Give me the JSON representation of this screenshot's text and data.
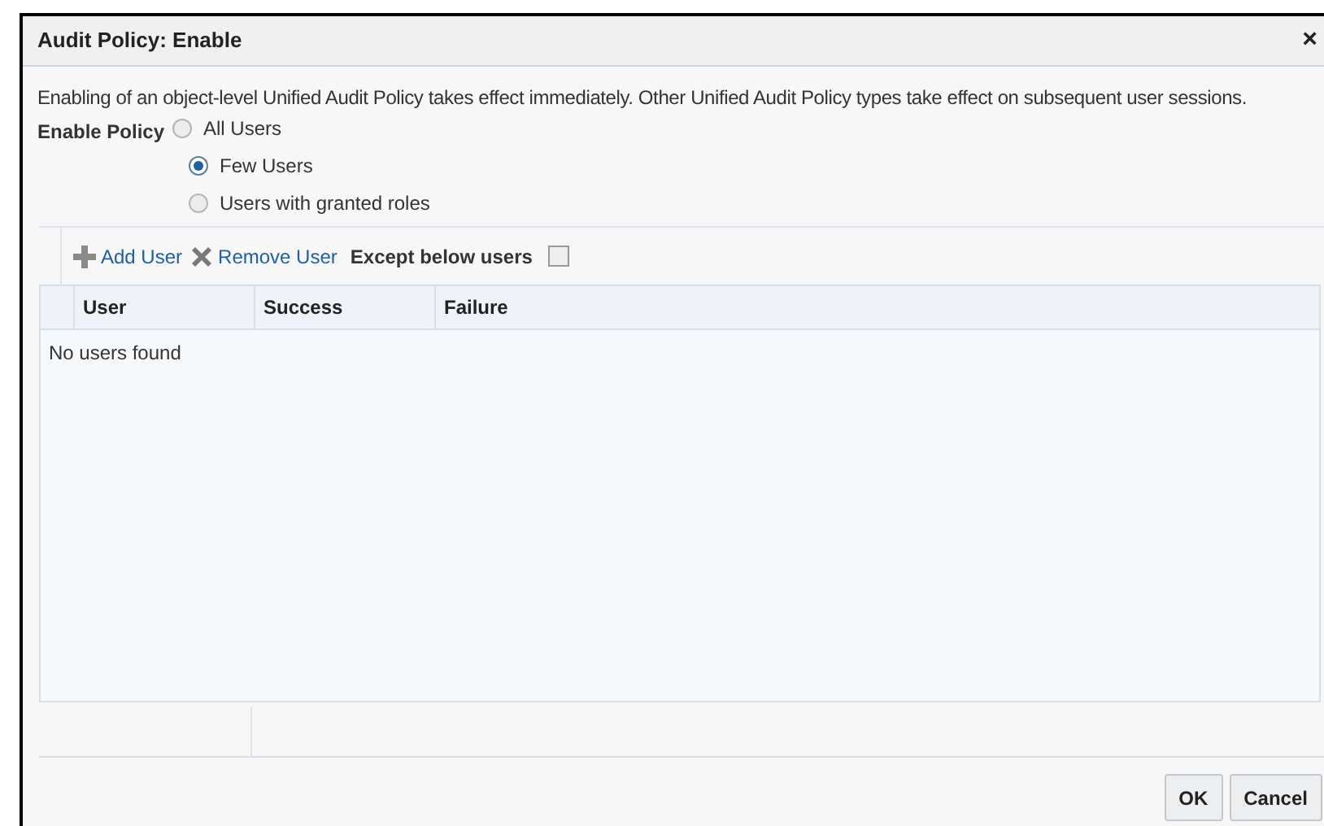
{
  "dialog": {
    "title": "Audit Policy: Enable",
    "close": "×"
  },
  "description": "Enabling of an object-level Unified Audit Policy takes effect immediately. Other Unified Audit Policy types take effect on subsequent user sessions.",
  "enable_policy": {
    "label": "Enable Policy",
    "options": [
      {
        "label": "All Users",
        "selected": false
      },
      {
        "label": "Few Users",
        "selected": true
      },
      {
        "label": "Users with granted roles",
        "selected": false
      }
    ]
  },
  "toolbar": {
    "add": "Add User",
    "remove": "Remove User",
    "except_label": "Except below users",
    "except_checked": false
  },
  "table": {
    "columns": [
      "User",
      "Success",
      "Failure"
    ],
    "empty_message": "No users found"
  },
  "buttons": [
    "OK",
    "Cancel"
  ]
}
